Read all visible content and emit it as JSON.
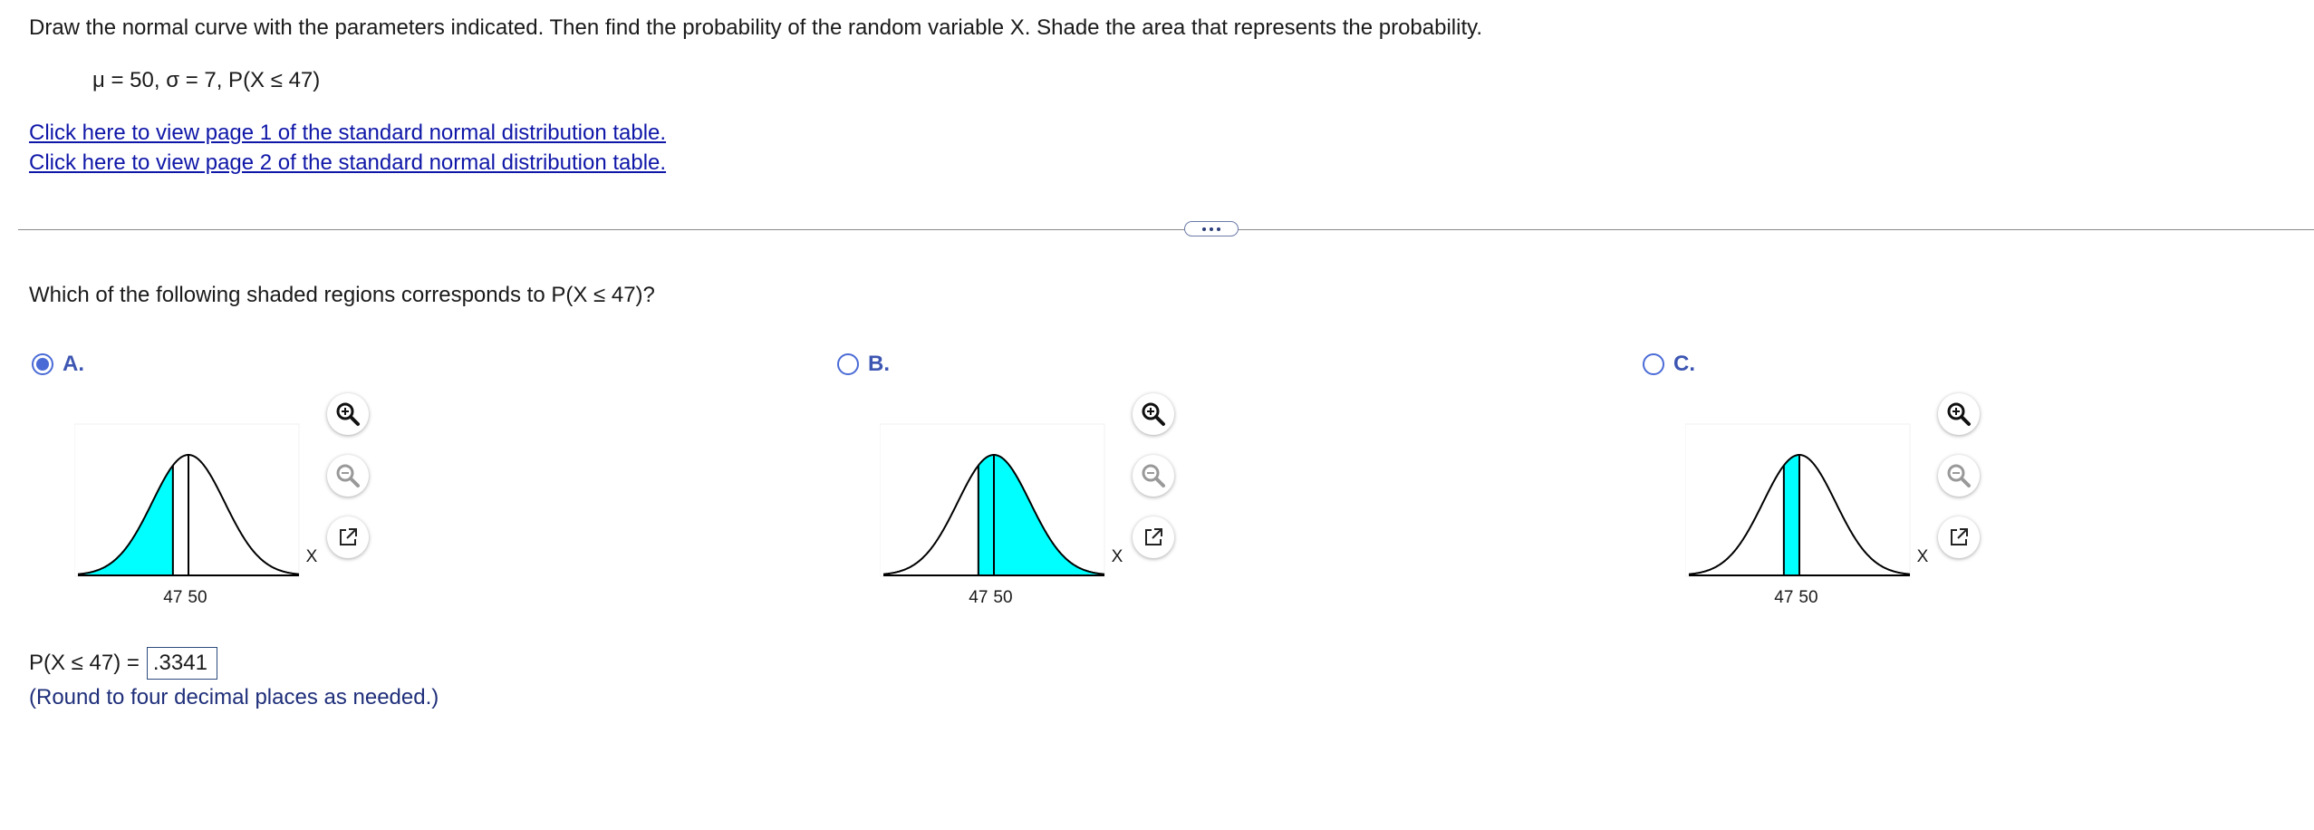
{
  "question": {
    "instruction": "Draw the normal curve with the parameters indicated. Then find the probability of the random variable X. Shade the area that represents the probability.",
    "parameters": "μ = 50, σ = 7, P(X ≤ 47)",
    "links": [
      "Click here to view page 1 of the standard normal distribution table.",
      "Click here to view page 2 of the standard normal distribution table."
    ],
    "prompt": "Which of the following shaded regions corresponds to P(X ≤ 47)?"
  },
  "choices": [
    {
      "label": "A.",
      "selected": true,
      "shading": "left-tail",
      "tick_labels": [
        "47",
        "50"
      ],
      "axis_label": "X"
    },
    {
      "label": "B.",
      "selected": false,
      "shading": "right-of-47",
      "tick_labels": [
        "47",
        "50"
      ],
      "axis_label": "X"
    },
    {
      "label": "C.",
      "selected": false,
      "shading": "between",
      "tick_labels": [
        "47",
        "50"
      ],
      "axis_label": "X"
    }
  ],
  "tools": {
    "zoom_in_icon": "zoom-in-icon",
    "zoom_out_icon": "zoom-out-icon",
    "popout_icon": "popout-icon"
  },
  "answer": {
    "label": "P(X ≤ 47) =",
    "value": ".3341",
    "note": "(Round to four decimal places as needed.)"
  },
  "colors": {
    "shade": "#00ffff",
    "link": "#0f17a8",
    "radio": "#4a6bd6"
  }
}
